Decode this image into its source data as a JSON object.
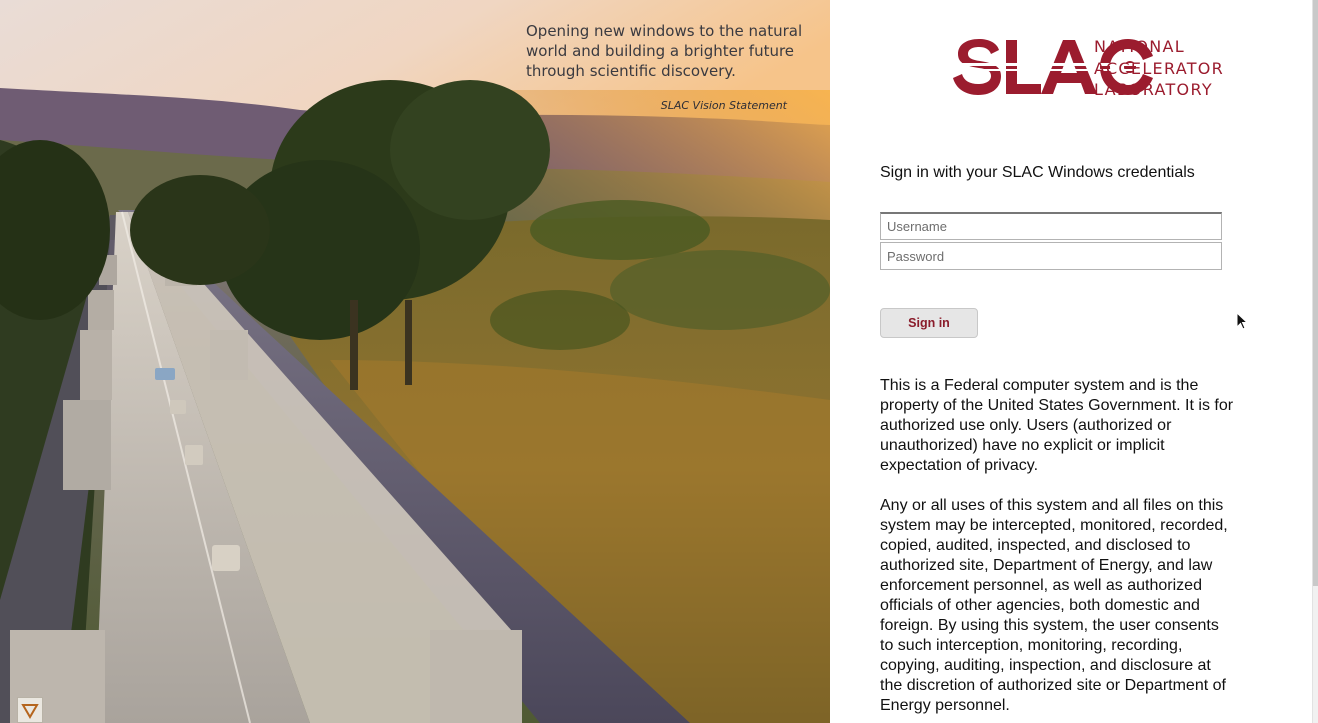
{
  "hero": {
    "vision_quote": "Opening new windows to the natural world and building a brighter future through scientific discovery.",
    "vision_credit": "SLAC Vision Statement"
  },
  "logo": {
    "wordmark": "SLAC",
    "subtitle_line1": "NATIONAL",
    "subtitle_line2": "ACCELERATOR",
    "subtitle_line3": "LABORATORY",
    "brand_color": "#9b1c2e"
  },
  "login": {
    "heading": "Sign in with your SLAC Windows credentials",
    "username_placeholder": "Username",
    "username_value": "",
    "password_placeholder": "Password",
    "password_value": "",
    "signin_label": "Sign in"
  },
  "notice": {
    "paragraph1": "This is a Federal computer system and is the property of the United States Government. It is for authorized use only. Users (authorized or unauthorized) have no explicit or implicit expectation of privacy.",
    "paragraph2": "Any or all uses of this system and all files on this system may be intercepted, monitored, recorded, copied, audited, inspected, and disclosed to authorized site, Department of Energy, and law enforcement personnel, as well as authorized officials of other agencies, both domestic and foreign. By using this system, the user consents to such interception, monitoring, recording, copying, auditing, inspection, and disclosure at the discretion of authorized site or Department of Energy personnel."
  },
  "icons": {
    "cursor": "mouse-pointer-icon",
    "corner": "warning-triangle-icon"
  }
}
